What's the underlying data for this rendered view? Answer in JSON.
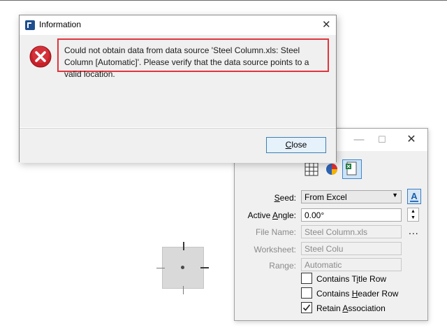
{
  "canvas": {},
  "info_dialog": {
    "title": "Information",
    "message": "Could not obtain data from data source 'Steel Column.xls: Steel Column [Automatic]'. Please verify that the data source points to a valid location.",
    "close_label": "Close",
    "close_mnemonic": "C",
    "close_rest": "lose"
  },
  "place_dialog": {
    "window_buttons": {
      "minimize": "—",
      "maximize": "☐",
      "close": "✕"
    },
    "modes": [
      "grid-icon",
      "pie-chart-icon",
      "excel-icon"
    ],
    "seed": {
      "label_pre": "",
      "label_mn": "S",
      "label_post": "eed:",
      "value": "From Excel"
    },
    "active_angle": {
      "label_pre": "Active ",
      "label_mn": "A",
      "label_post": "ngle:",
      "value": "0.00°"
    },
    "file_name": {
      "label": "File Name:",
      "value": "Steel Column.xls"
    },
    "worksheet": {
      "label": "Worksheet:",
      "value": "Steel Colu"
    },
    "range": {
      "label": "Range:",
      "value": "Automatic"
    },
    "ellipsis": "...",
    "font_button": "A",
    "options": [
      {
        "pre": "Contains T",
        "mn": "i",
        "post": "tle Row",
        "checked": false
      },
      {
        "pre": "Contains ",
        "mn": "H",
        "post": "eader Row",
        "checked": false
      },
      {
        "pre": "Retain ",
        "mn": "A",
        "post": "ssociation",
        "checked": true
      }
    ]
  },
  "colors": {
    "accent": "#3c7fb1",
    "highlight_border": "#e0353d",
    "error_icon": "#c8202a"
  }
}
